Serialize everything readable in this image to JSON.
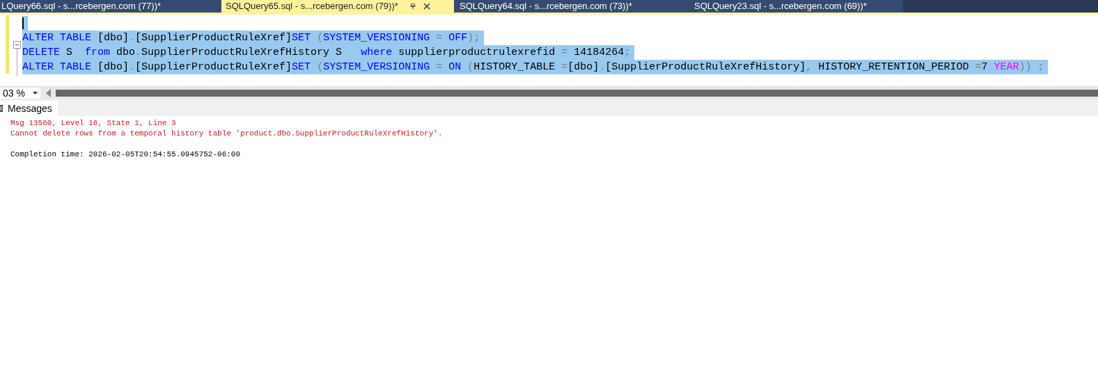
{
  "tabs": [
    {
      "label": "LQuery66.sql - s...rcebergen.com (77))*",
      "selected": false
    },
    {
      "label": "SQLQuery65.sql - s...rcebergen.com (79))*",
      "selected": true
    },
    {
      "label": "SQLQuery64.sql - s...rcebergen.com (73))*",
      "selected": false
    },
    {
      "label": "SQLQuery23.sql - s...rcebergen.com (69))*",
      "selected": false
    }
  ],
  "editor": {
    "lines": [
      {
        "selected": true,
        "cursor": true
      },
      {
        "selected": true,
        "cursor": false,
        "tokens": [
          {
            "t": "ALTER TABLE",
            "kind": "kw"
          },
          {
            "t": " [dbo]",
            "kind": "id"
          },
          {
            "t": ".",
            "kind": "op"
          },
          {
            "t": "[SupplierProductRuleXref]",
            "kind": "id"
          },
          {
            "t": "SET",
            "kind": "kw"
          },
          {
            "t": " (",
            "kind": "op"
          },
          {
            "t": "SYSTEM_VERSIONING",
            "kind": "kw"
          },
          {
            "t": " = ",
            "kind": "op"
          },
          {
            "t": "OFF",
            "kind": "kw"
          },
          {
            "t": ");",
            "kind": "op"
          }
        ]
      },
      {
        "selected": true,
        "cursor": false,
        "tokens": [
          {
            "t": "DELETE",
            "kind": "kw"
          },
          {
            "t": " S  ",
            "kind": "id"
          },
          {
            "t": "from",
            "kind": "kw"
          },
          {
            "t": " dbo",
            "kind": "id"
          },
          {
            "t": ".",
            "kind": "op"
          },
          {
            "t": "SupplierProductRuleXrefHistory S   ",
            "kind": "id"
          },
          {
            "t": "where",
            "kind": "kw"
          },
          {
            "t": " supplierproductrulexrefid ",
            "kind": "id"
          },
          {
            "t": "=",
            "kind": "op"
          },
          {
            "t": " 14184264",
            "kind": "id"
          },
          {
            "t": ";",
            "kind": "op"
          }
        ]
      },
      {
        "selected": true,
        "cursor": false,
        "tokens": [
          {
            "t": "ALTER TABLE",
            "kind": "kw"
          },
          {
            "t": " [dbo]",
            "kind": "id"
          },
          {
            "t": ".",
            "kind": "op"
          },
          {
            "t": "[SupplierProductRuleXref]",
            "kind": "id"
          },
          {
            "t": "SET",
            "kind": "kw"
          },
          {
            "t": " (",
            "kind": "op"
          },
          {
            "t": "SYSTEM_VERSIONING",
            "kind": "kw"
          },
          {
            "t": " = ",
            "kind": "op"
          },
          {
            "t": "ON",
            "kind": "kw"
          },
          {
            "t": " (",
            "kind": "op"
          },
          {
            "t": "HISTORY_TABLE ",
            "kind": "id"
          },
          {
            "t": "=",
            "kind": "op"
          },
          {
            "t": "[dbo]",
            "kind": "id"
          },
          {
            "t": ".",
            "kind": "op"
          },
          {
            "t": "[SupplierProductRuleXrefHistory]",
            "kind": "id"
          },
          {
            "t": ", ",
            "kind": "op"
          },
          {
            "t": "HISTORY_RETENTION_PERIOD ",
            "kind": "id"
          },
          {
            "t": "=",
            "kind": "op"
          },
          {
            "t": "7 ",
            "kind": "id"
          },
          {
            "t": "YEAR",
            "kind": "fn"
          },
          {
            "t": ")) ;",
            "kind": "op"
          }
        ]
      }
    ]
  },
  "zoom": {
    "value": "03 %"
  },
  "results": {
    "tab": "Messages",
    "lines": [
      {
        "text": "Msg 13560, Level 16, State 1, Line 3",
        "kind": "error"
      },
      {
        "text": "Cannot delete rows from a temporal history table 'product.dbo.SupplierProductRuleXrefHistory'.",
        "kind": "error"
      },
      {
        "text": "Completion time: 2026-02-05T20:54:55.0945752-06:00",
        "kind": "info"
      }
    ]
  }
}
